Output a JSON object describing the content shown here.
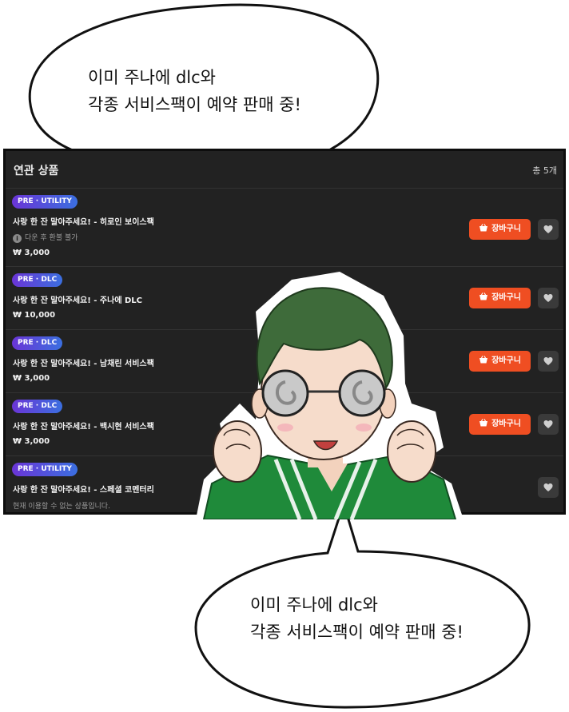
{
  "bubbles": {
    "top": {
      "line1": "이미 주나에 dlc와",
      "line2": "각종 서비스팩이 예약 판매 중!"
    },
    "bottom": {
      "line1": "이미 주나에 dlc와",
      "line2": "각종 서비스팩이 예약 판매 중!"
    }
  },
  "panel": {
    "title": "연관 상품",
    "count": "총 5개",
    "cart_label": "장바구니",
    "items": [
      {
        "badge": "PRE · UTILITY",
        "title": "사랑 한 잔 말아주세요! - 히로인 보이스팩",
        "note": "다운 후 환불 불가",
        "price": "₩ 3,000"
      },
      {
        "badge": "PRE · DLC",
        "title": "사랑 한 잔 말아주세요! - 주나에 DLC",
        "price": "₩ 10,000"
      },
      {
        "badge": "PRE · DLC",
        "title": "사랑 한 잔 말아주세요! - 남채린 서비스팩",
        "price": "₩ 3,000"
      },
      {
        "badge": "PRE · DLC",
        "title": "사랑 한 잔 말아주세요! - 백시현 서비스팩",
        "price": "₩ 3,000"
      },
      {
        "badge": "PRE · UTILITY",
        "title": "사랑 한 잔 말아주세요! - 스페셜 코멘터리",
        "note": "현재 이용할 수 없는 상품입니다."
      }
    ]
  },
  "colors": {
    "panel_bg": "#222222",
    "cart_button": "#ef4e22",
    "badge_start": "#6a35d6",
    "badge_end": "#3b6fe0"
  },
  "icons": [
    "info-icon",
    "basket-icon",
    "heart-icon"
  ]
}
